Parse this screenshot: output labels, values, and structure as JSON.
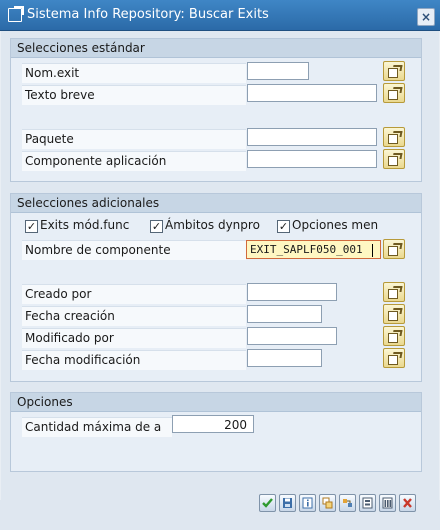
{
  "window": {
    "title": "Sistema Info Repository: Buscar Exits",
    "close_label": "×"
  },
  "sections": {
    "standard": {
      "title": "Selecciones estándar",
      "fields": [
        {
          "label": "Nom.exit",
          "value": ""
        },
        {
          "label": "Texto breve",
          "value": ""
        },
        {
          "label": "Paquete",
          "value": ""
        },
        {
          "label": "Componente aplicación",
          "value": ""
        }
      ]
    },
    "additional": {
      "title": "Selecciones adicionales",
      "checkboxes": [
        {
          "label": "Exits mód.func",
          "checked": true
        },
        {
          "label": "Ámbitos dynpro",
          "checked": true
        },
        {
          "label": "Opciones men",
          "checked": true
        }
      ],
      "component": {
        "label": "Nombre de componente",
        "value": "EXIT_SAPLF050_001"
      },
      "fields": [
        {
          "label": "Creado por",
          "value": ""
        },
        {
          "label": "Fecha creación",
          "value": ""
        },
        {
          "label": "Modificado por",
          "value": ""
        },
        {
          "label": "Fecha modificación",
          "value": ""
        }
      ]
    },
    "options": {
      "title": "Opciones",
      "max_hits": {
        "label": "Cantidad máxima de a",
        "value": "200"
      }
    }
  },
  "icons": {
    "checkbox_mark": "✓",
    "toolbar": [
      "execute-icon",
      "save-variant-icon",
      "info-icon",
      "multi-selection-icon",
      "settings-icon",
      "delete-selection-icon",
      "layout-icon",
      "cancel-icon"
    ]
  },
  "colors": {
    "title_bar": "#2b6aa8",
    "focused_field": "#fff7c2",
    "execute": "#2f9a2f",
    "cancel": "#c9392b"
  }
}
